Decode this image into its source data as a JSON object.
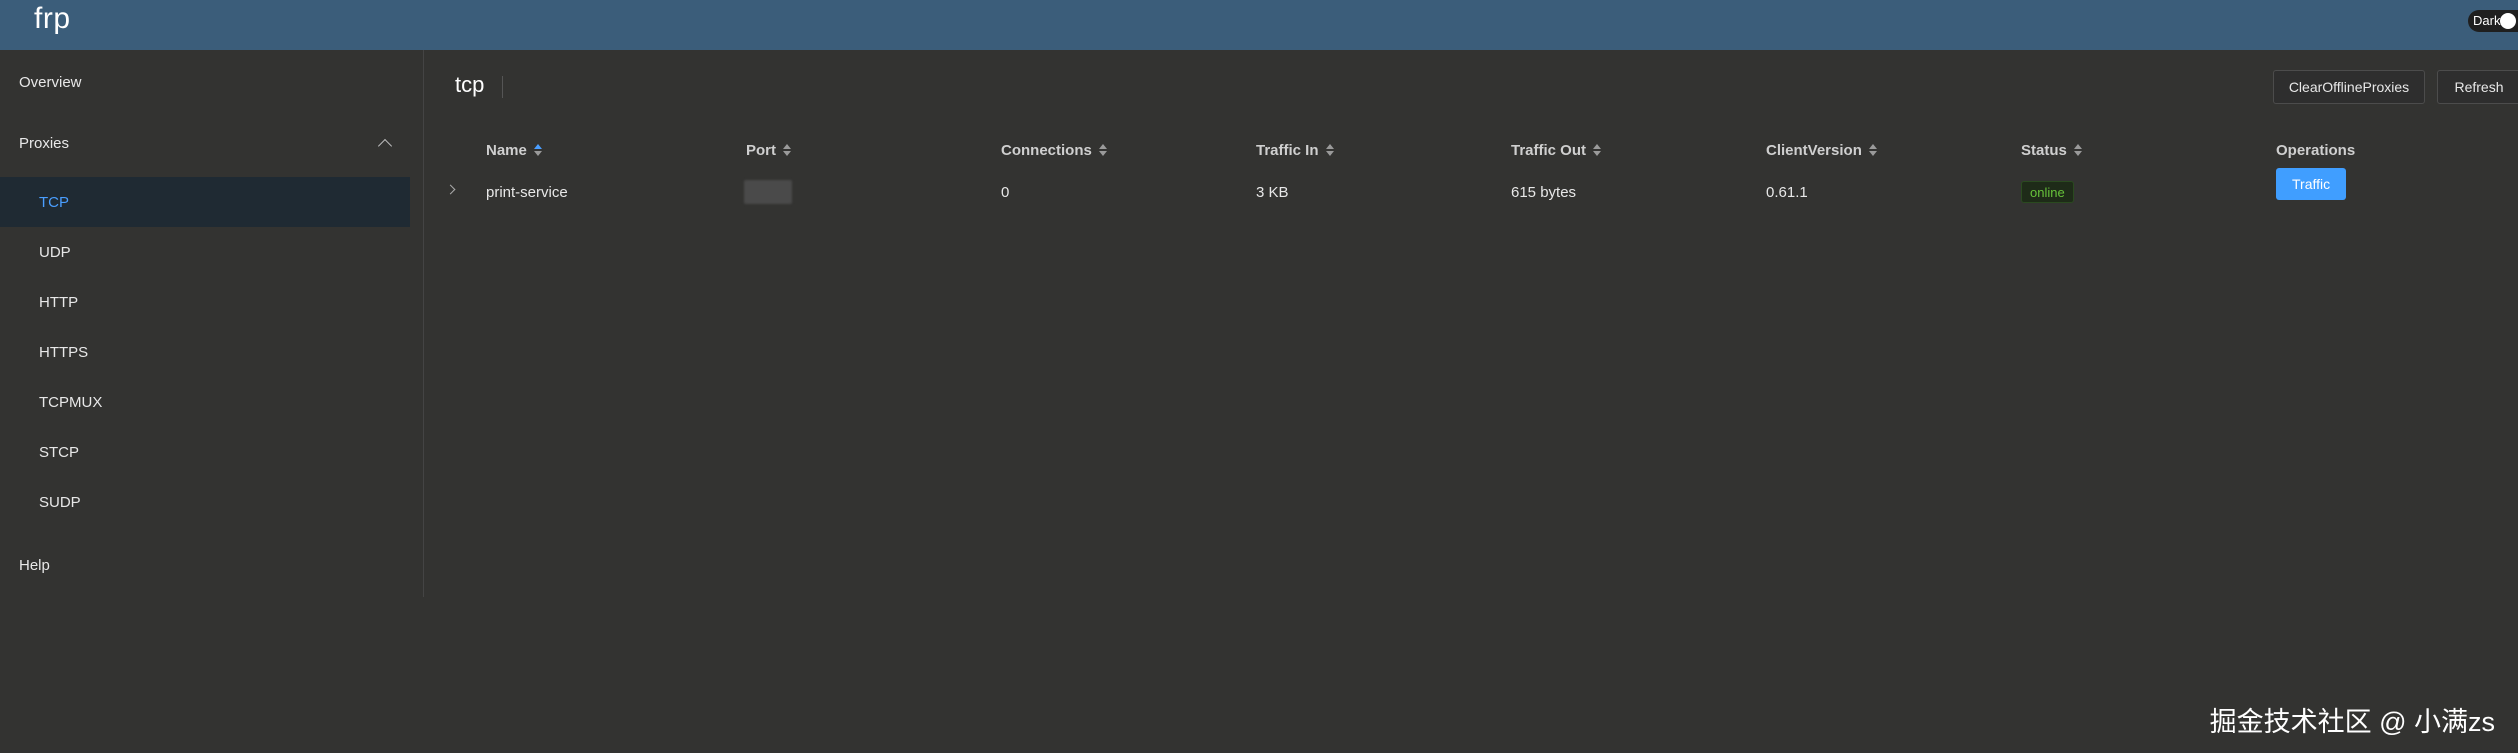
{
  "header": {
    "logo": "frp",
    "theme_label": "Dark"
  },
  "sidebar": {
    "overview": "Overview",
    "proxies": "Proxies",
    "items": [
      "TCP",
      "UDP",
      "HTTP",
      "HTTPS",
      "TCPMUX",
      "STCP",
      "SUDP"
    ],
    "active": "TCP",
    "help": "Help"
  },
  "main": {
    "title": "tcp",
    "clear_button": "ClearOfflineProxies",
    "refresh_button": "Refresh"
  },
  "table": {
    "columns": [
      "Name",
      "Port",
      "Connections",
      "Traffic In",
      "Traffic Out",
      "ClientVersion",
      "Status",
      "Operations"
    ],
    "rows": [
      {
        "name": "print-service",
        "port": "",
        "connections": "0",
        "traffic_in": "3 KB",
        "traffic_out": "615 bytes",
        "client_version": "0.61.1",
        "status": "online",
        "operation": "Traffic"
      }
    ]
  },
  "colors": {
    "header_bg": "#3b5d7a",
    "accent": "#409eff",
    "status_online": "#67c23a",
    "page_bg": "#333331"
  },
  "watermark": "掘金技术社区 @ 小满zs"
}
